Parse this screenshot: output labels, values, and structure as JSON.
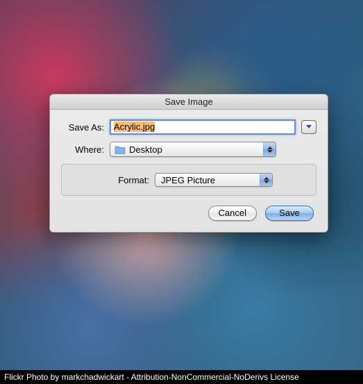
{
  "dialog": {
    "title": "Save Image",
    "saveas_label": "Save As:",
    "filename": "Acrylic.jpg",
    "where_label": "Where:",
    "where_value": "Desktop",
    "format_label": "Format:",
    "format_value": "JPEG Picture",
    "cancel_label": "Cancel",
    "save_label": "Save"
  },
  "caption": "Flickr Photo by markchadwickart - Attribution-NonCommercial-NoDerivs License"
}
